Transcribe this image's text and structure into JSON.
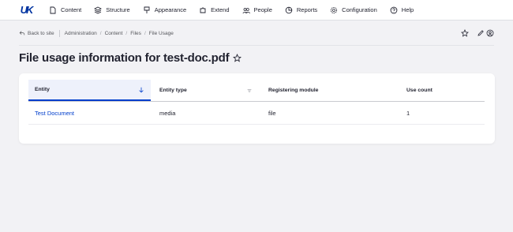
{
  "brand": {
    "logo_text": "UK",
    "logo_color": "#0033a0"
  },
  "toolbar": {
    "items": [
      {
        "label": "Content",
        "icon": "file-icon"
      },
      {
        "label": "Structure",
        "icon": "layers-icon"
      },
      {
        "label": "Appearance",
        "icon": "paint-icon"
      },
      {
        "label": "Extend",
        "icon": "puzzle-icon"
      },
      {
        "label": "People",
        "icon": "people-icon"
      },
      {
        "label": "Reports",
        "icon": "chart-icon"
      },
      {
        "label": "Configuration",
        "icon": "gear-icon"
      },
      {
        "label": "Help",
        "icon": "help-icon"
      }
    ]
  },
  "breadcrumb": {
    "back_label": "Back to site",
    "items": [
      "Administration",
      "Content",
      "Files",
      "File Usage"
    ]
  },
  "page": {
    "title": "File usage information for test-doc.pdf"
  },
  "table": {
    "headers": {
      "entity": "Entity",
      "entity_type": "Entity type",
      "registering_module": "Registering module",
      "use_count": "Use count"
    },
    "rows": [
      {
        "entity": "Test Document",
        "entity_type": "media",
        "registering_module": "file",
        "use_count": "1"
      }
    ]
  },
  "colors": {
    "accent": "#003ecc",
    "background": "#f2f2f5",
    "header_active_bg": "#eef1fb"
  }
}
